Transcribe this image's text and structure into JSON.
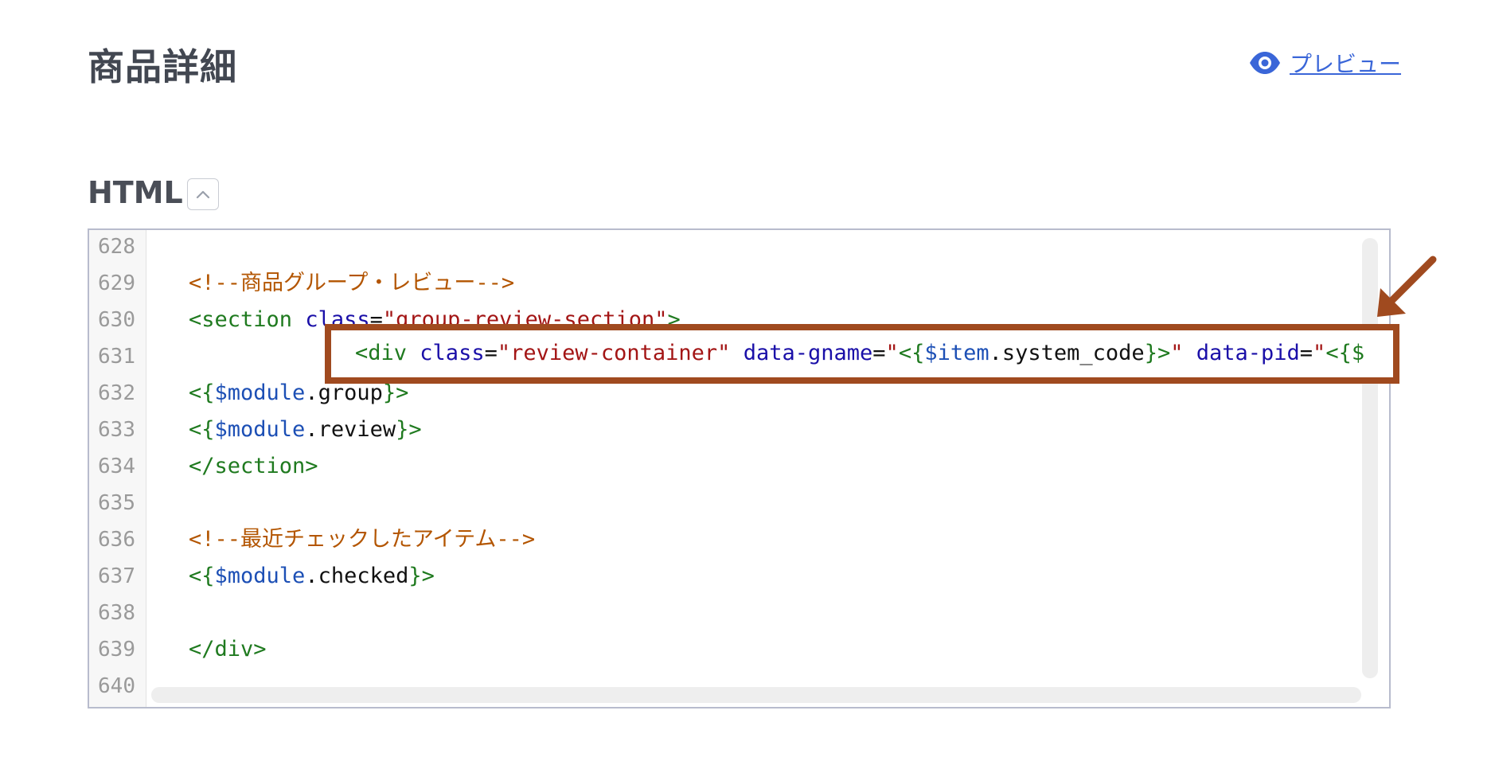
{
  "header": {
    "title": "商品詳細",
    "preview_label": "プレビュー"
  },
  "section": {
    "label": "HTML"
  },
  "editor": {
    "line_numbers": [
      "628",
      "629",
      "630",
      "631",
      "632",
      "633",
      "634",
      "635",
      "636",
      "637",
      "638",
      "639",
      "640"
    ],
    "lines": {
      "l629": {
        "comment": "<!--商品グループ・レビュー-->"
      },
      "l630": {
        "tag_open": "<section",
        "attr": "class",
        "eq": "=",
        "value": "\"group-review-section\"",
        "tag_close": ">"
      },
      "l631": {
        "tag_open": "<div",
        "attr1": "class",
        "eq1": "=",
        "val1": "\"review-container\"",
        "attr2": "data-gname",
        "eq2": "=",
        "q2a": "\"",
        "b2a": "<{",
        "var2": "$item",
        "prop2": ".system_code",
        "b2b": "}>",
        "q2b": "\"",
        "attr3": "data-pid",
        "eq3": "=",
        "q3a": "\"",
        "b3a": "<{$"
      },
      "l632": {
        "open": "<{",
        "var": "$module",
        "prop": ".group",
        "close": "}>"
      },
      "l633": {
        "open": "<{",
        "var": "$module",
        "prop": ".review",
        "close": "}>"
      },
      "l634": {
        "tag": "</section>"
      },
      "l636": {
        "comment": "<!--最近チェックしたアイテム-->"
      },
      "l637": {
        "open": "<{",
        "var": "$module",
        "prop": ".checked",
        "close": "}>"
      },
      "l639": {
        "tag": "</div>"
      }
    }
  },
  "colors": {
    "annotation": "#a04a1f",
    "link": "#3a66d8",
    "tag": "#1f7a1f",
    "attr": "#1a0fa8",
    "string": "#a31515",
    "comment": "#b35500",
    "variable": "#1c4fb5"
  },
  "icons": {
    "preview": "eye-icon",
    "collapse": "chevron-up-icon",
    "annotation": "arrow-down-left-icon"
  }
}
